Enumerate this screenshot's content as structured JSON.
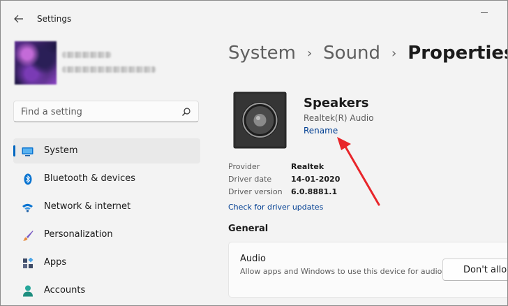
{
  "app": {
    "title": "Settings"
  },
  "search": {
    "placeholder": "Find a setting",
    "value": ""
  },
  "sidebar": {
    "items": [
      {
        "label": "System",
        "icon": "monitor-icon",
        "active": true
      },
      {
        "label": "Bluetooth & devices",
        "icon": "bluetooth-icon",
        "active": false
      },
      {
        "label": "Network & internet",
        "icon": "wifi-icon",
        "active": false
      },
      {
        "label": "Personalization",
        "icon": "brush-icon",
        "active": false
      },
      {
        "label": "Apps",
        "icon": "apps-icon",
        "active": false
      },
      {
        "label": "Accounts",
        "icon": "person-icon",
        "active": false
      }
    ]
  },
  "breadcrumb": {
    "items": [
      "System",
      "Sound"
    ],
    "current": "Properties",
    "separator": "›"
  },
  "device": {
    "name": "Speakers",
    "subtitle": "Realtek(R) Audio",
    "rename_label": "Rename",
    "icon": "speaker-icon"
  },
  "properties": [
    {
      "label": "Provider",
      "value": "Realtek"
    },
    {
      "label": "Driver date",
      "value": "14-01-2020"
    },
    {
      "label": "Driver version",
      "value": "6.0.8881.1"
    }
  ],
  "driver_link": "Check for driver updates",
  "general": {
    "title": "General",
    "audio_card": {
      "title": "Audio",
      "description": "Allow apps and Windows to use this device for audio",
      "button_label": "Don't allow"
    }
  },
  "colors": {
    "accent": "#0067c0",
    "link": "#003e92",
    "annotation": "#e8252a"
  }
}
